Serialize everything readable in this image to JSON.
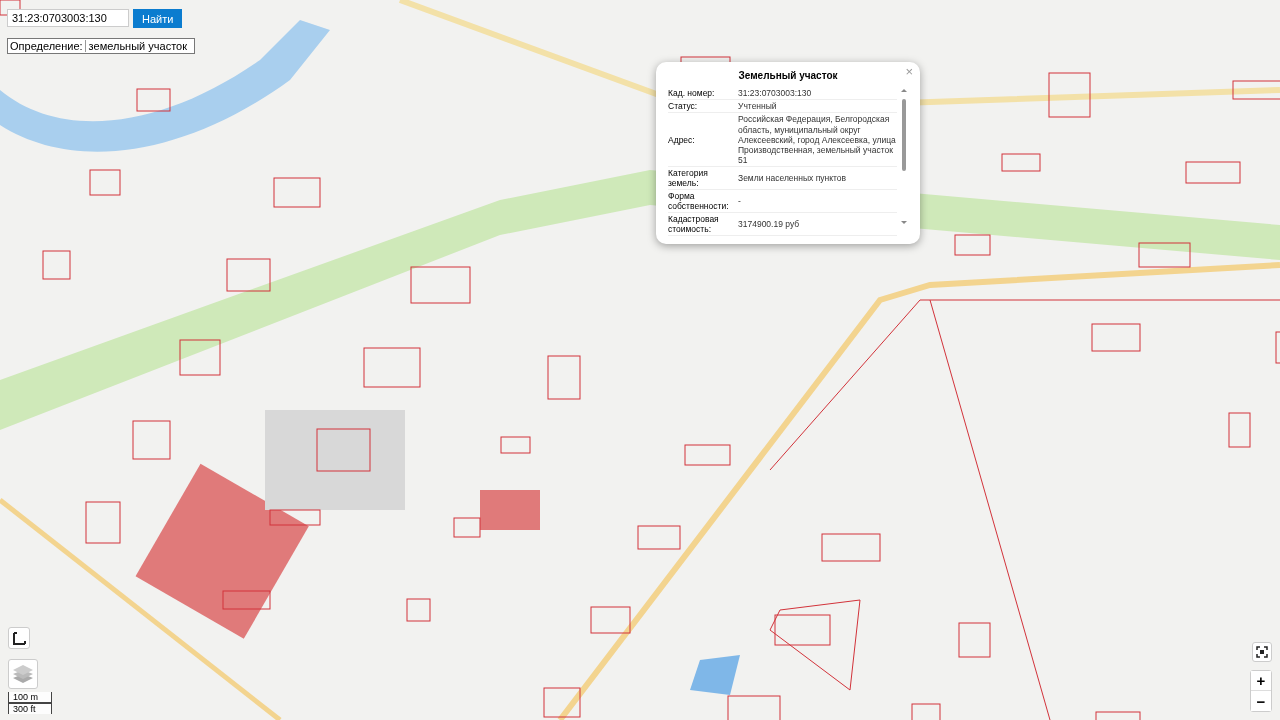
{
  "search": {
    "value": "31:23:0703003:130",
    "button": "Найти"
  },
  "definition": {
    "label": "Определение:",
    "value": "земельный участок"
  },
  "popup": {
    "title": "Земельный участок",
    "close": "×",
    "rows": [
      {
        "label": "Кад. номер:",
        "value": "31:23:0703003:130"
      },
      {
        "label": "Статус:",
        "value": "Учтенный"
      },
      {
        "label": "Адрес:",
        "value": "Российская Федерация, Белгородская область, муниципальный округ Алексеевский, город Алексеевка, улица Производственная, земельный участок 51"
      },
      {
        "label": "Категория земель:",
        "value": "Земли населенных пунктов"
      },
      {
        "label": "Форма собственности:",
        "value": "-"
      },
      {
        "label": "Кадастровая стоимость:",
        "value": "3174900.19 руб"
      }
    ]
  },
  "scale": [
    "100 m",
    "300 ft"
  ],
  "zoom": {
    "in": "+",
    "out": "−"
  }
}
